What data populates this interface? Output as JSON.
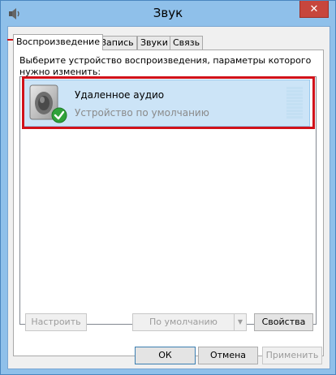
{
  "window": {
    "title": "Звук",
    "close_label": "✕",
    "accent": "#d1121a"
  },
  "tabs": [
    {
      "label": "Воспроизведение",
      "active": true
    },
    {
      "label": "Запись",
      "active": false
    },
    {
      "label": "Звуки",
      "active": false
    },
    {
      "label": "Связь",
      "active": false
    }
  ],
  "playback": {
    "instruction": "Выберите устройство воспроизведения, параметры которого нужно изменить:",
    "devices": [
      {
        "name": "Удаленное аудио",
        "status": "Устройство по умолчанию",
        "icon": "speaker-icon",
        "default_badge": "green-check-icon"
      }
    ],
    "configure_label": "Настроить",
    "set_default_label": "По умолчанию",
    "properties_label": "Свойства"
  },
  "footer": {
    "ok_label": "ОК",
    "cancel_label": "Отмена",
    "apply_label": "Применить"
  }
}
